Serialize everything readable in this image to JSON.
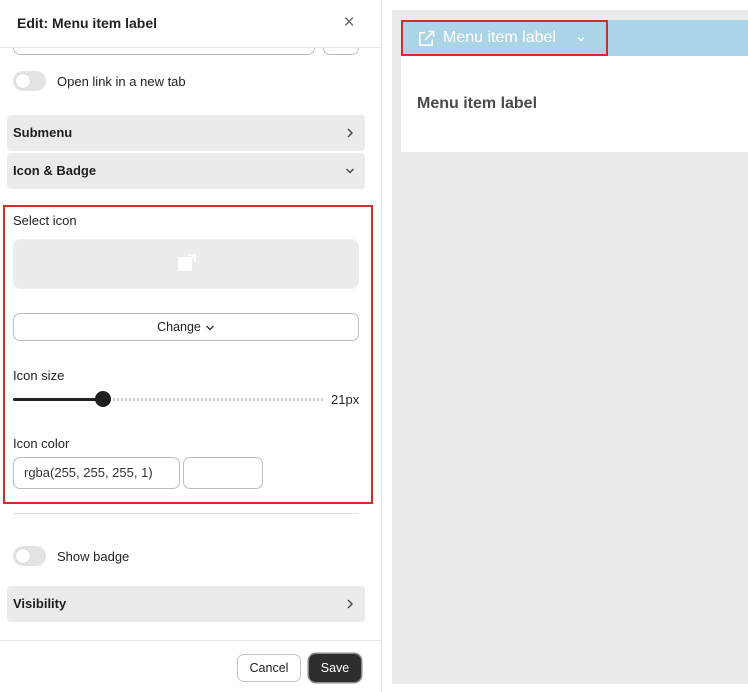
{
  "panel": {
    "title": "Edit: Menu item label",
    "close_label": "×",
    "open_new_tab_label": "Open link in a new tab",
    "open_new_tab_enabled": false,
    "sections": {
      "submenu": "Submenu",
      "icon_badge": "Icon & Badge",
      "visibility": "Visibility"
    },
    "icon_settings": {
      "select_icon_label": "Select icon",
      "selected_icon": "external-link-icon",
      "change_label": "Change",
      "size_label": "Icon size",
      "size_value": 21,
      "size_value_text": "21px",
      "size_fraction": 0.29,
      "color_label": "Icon color",
      "color_value": "rgba(255, 255, 255, 1)",
      "color_swatch": "#ffffff"
    },
    "show_badge_label": "Show badge",
    "show_badge_enabled": false,
    "footer": {
      "cancel_label": "Cancel",
      "save_label": "Save"
    }
  },
  "preview": {
    "menu_item_label": "Menu item label",
    "menu_item_icon": "external-link-icon",
    "content_label": "Menu item label",
    "menubar_color": "#abd4e6",
    "highlight_color": "#d42b2b"
  }
}
